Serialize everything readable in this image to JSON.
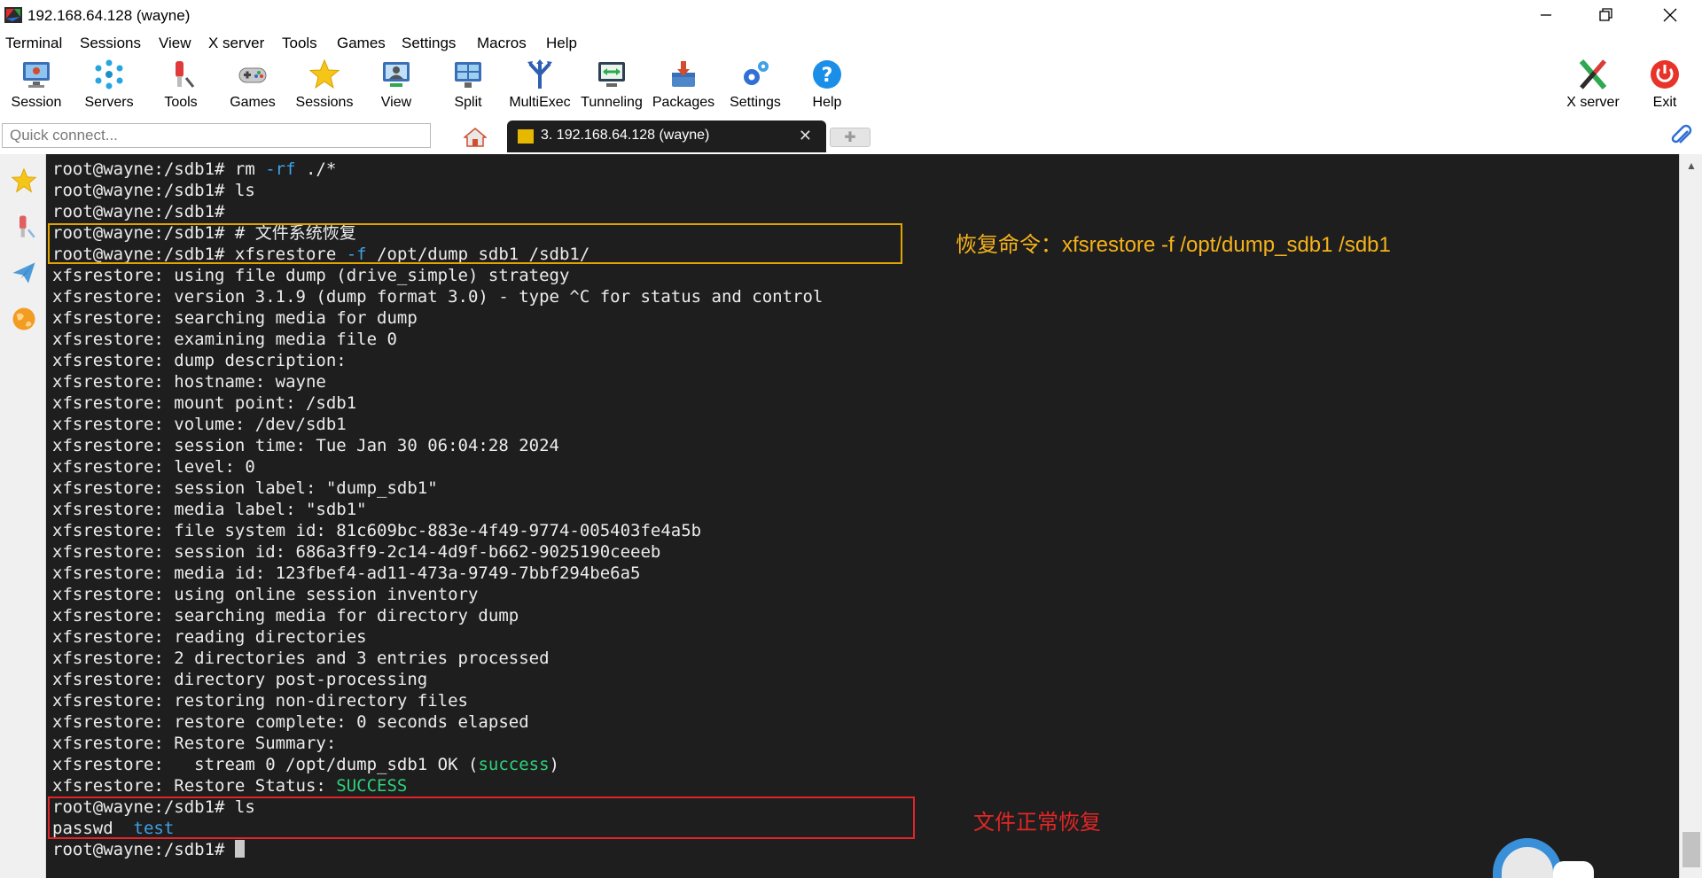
{
  "window": {
    "title": "192.168.64.128 (wayne)",
    "controls": [
      "minimize",
      "restore",
      "close"
    ]
  },
  "menu": [
    "Terminal",
    "Sessions",
    "View",
    "X server",
    "Tools",
    "Games",
    "Settings",
    "Macros",
    "Help"
  ],
  "toolbar": {
    "session": "Session",
    "servers": "Servers",
    "tools": "Tools",
    "games": "Games",
    "sessions": "Sessions",
    "view": "View",
    "split": "Split",
    "multiexec": "MultiExec",
    "tunneling": "Tunneling",
    "packages": "Packages",
    "settings": "Settings",
    "help": "Help",
    "xserver": "X server",
    "exit": "Exit"
  },
  "tabs": {
    "quick_connect_placeholder": "Quick connect...",
    "active_tab_label": "3. 192.168.64.128 (wayne)",
    "close_glyph": "✕",
    "new_tab_glyph": "✚"
  },
  "side_panel": [
    "star-icon",
    "tools-icon",
    "send-icon",
    "globe-icon"
  ],
  "terminal": {
    "lines": [
      {
        "segs": [
          {
            "t": "root@wayne:/sdb1# rm "
          },
          {
            "t": "-rf",
            "c": "blue"
          },
          {
            "t": " ./*"
          }
        ]
      },
      {
        "segs": [
          {
            "t": "root@wayne:/sdb1# ls"
          }
        ]
      },
      {
        "segs": [
          {
            "t": "root@wayne:/sdb1#"
          }
        ]
      },
      {
        "segs": [
          {
            "t": "root@wayne:/sdb1# # 文件系统恢复"
          }
        ]
      },
      {
        "segs": [
          {
            "t": "root@wayne:/sdb1# xfsrestore "
          },
          {
            "t": "-f",
            "c": "blue"
          },
          {
            "t": " /opt/dump_sdb1 /sdb1/"
          }
        ]
      },
      {
        "segs": [
          {
            "t": "xfsrestore: using file dump (drive_simple) strategy"
          }
        ]
      },
      {
        "segs": [
          {
            "t": "xfsrestore: version 3.1.9 (dump format 3.0) - type ^C for status and control"
          }
        ]
      },
      {
        "segs": [
          {
            "t": "xfsrestore: searching media for dump"
          }
        ]
      },
      {
        "segs": [
          {
            "t": "xfsrestore: examining media file 0"
          }
        ]
      },
      {
        "segs": [
          {
            "t": "xfsrestore: dump description:"
          }
        ]
      },
      {
        "segs": [
          {
            "t": "xfsrestore: hostname: wayne"
          }
        ]
      },
      {
        "segs": [
          {
            "t": "xfsrestore: mount point: /sdb1"
          }
        ]
      },
      {
        "segs": [
          {
            "t": "xfsrestore: volume: /dev/sdb1"
          }
        ]
      },
      {
        "segs": [
          {
            "t": "xfsrestore: session time: Tue Jan 30 06:04:28 2024"
          }
        ]
      },
      {
        "segs": [
          {
            "t": "xfsrestore: level: 0"
          }
        ]
      },
      {
        "segs": [
          {
            "t": "xfsrestore: session label: \"dump_sdb1\""
          }
        ]
      },
      {
        "segs": [
          {
            "t": "xfsrestore: media label: \"sdb1\""
          }
        ]
      },
      {
        "segs": [
          {
            "t": "xfsrestore: file system id: 81c609bc-883e-4f49-9774-005403fe4a5b"
          }
        ]
      },
      {
        "segs": [
          {
            "t": "xfsrestore: session id: 686a3ff9-2c14-4d9f-b662-9025190ceeeb"
          }
        ]
      },
      {
        "segs": [
          {
            "t": "xfsrestore: media id: 123fbef4-ad11-473a-9749-7bbf294be6a5"
          }
        ]
      },
      {
        "segs": [
          {
            "t": "xfsrestore: using online session inventory"
          }
        ]
      },
      {
        "segs": [
          {
            "t": "xfsrestore: searching media for directory dump"
          }
        ]
      },
      {
        "segs": [
          {
            "t": "xfsrestore: reading directories"
          }
        ]
      },
      {
        "segs": [
          {
            "t": "xfsrestore: 2 directories and 3 entries processed"
          }
        ]
      },
      {
        "segs": [
          {
            "t": "xfsrestore: directory post-processing"
          }
        ]
      },
      {
        "segs": [
          {
            "t": "xfsrestore: restoring non-directory files"
          }
        ]
      },
      {
        "segs": [
          {
            "t": "xfsrestore: restore complete: 0 seconds elapsed"
          }
        ]
      },
      {
        "segs": [
          {
            "t": "xfsrestore: Restore Summary:"
          }
        ]
      },
      {
        "segs": [
          {
            "t": "xfsrestore:   stream 0 /opt/dump_sdb1 OK ("
          },
          {
            "t": "success",
            "c": "green"
          },
          {
            "t": ")"
          }
        ]
      },
      {
        "segs": [
          {
            "t": "xfsrestore: Restore Status: "
          },
          {
            "t": "SUCCESS",
            "c": "green"
          }
        ]
      },
      {
        "segs": [
          {
            "t": "root@wayne:/sdb1# ls"
          }
        ]
      },
      {
        "segs": [
          {
            "t": "passwd  "
          },
          {
            "t": "test",
            "c": "blue"
          }
        ]
      },
      {
        "segs": [
          {
            "t": "root@wayne:/sdb1# "
          }
        ],
        "cursor": true
      }
    ]
  },
  "annotations": {
    "restore_cmd": "恢复命令：xfsrestore -f /opt/dump_sdb1 /sdb1",
    "restored_ok": "文件正常恢复"
  },
  "colors": {
    "terminal_bg": "#1e1e1e",
    "terminal_fg": "#ececec",
    "highlight_blue": "#3fa2e6",
    "highlight_green": "#2fd27a",
    "annotation_yellow": "#f5b21b",
    "annotation_red": "#e22626"
  }
}
